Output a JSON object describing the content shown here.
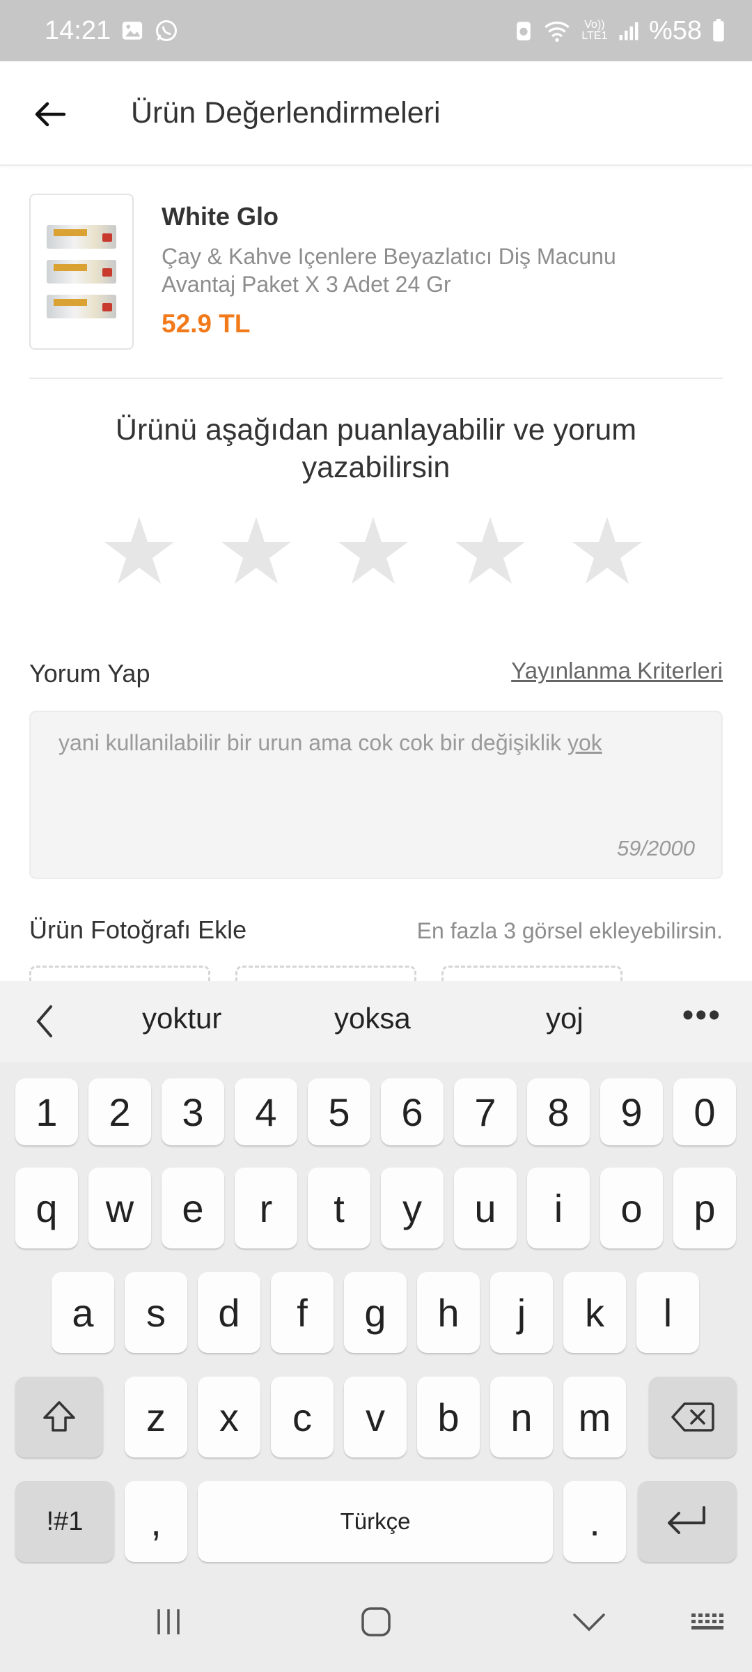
{
  "status_bar": {
    "time": "14:21",
    "network": "Vo)) LTE1",
    "battery": "%58"
  },
  "header": {
    "title": "Ürün Değerlendirmeleri"
  },
  "product": {
    "brand": "White Glo",
    "description": "Çay & Kahve Içenlere Beyazlatıcı Diş Macunu Avantaj Paket X 3 Adet 24 Gr",
    "price": "52.9 TL"
  },
  "rating": {
    "prompt": "Ürünü aşağıdan puanlayabilir ve yorum yazabilirsin",
    "max_stars": 5,
    "selected": 0
  },
  "review": {
    "label": "Yorum Yap",
    "criteria_link": "Yayınlanma Kriterleri",
    "text_main": "yani kullanilabilir bir urun ama cok cok bir değişiklik ",
    "text_underlined": "yok",
    "counter": "59/2000"
  },
  "photos": {
    "label": "Ürün Fotoğrafı Ekle",
    "hint": "En fazla 3 görsel ekleyebilirsin."
  },
  "keyboard": {
    "suggestions": [
      "yoktur",
      "yoksa",
      "yoj"
    ],
    "more": "•••",
    "row_numbers": [
      "1",
      "2",
      "3",
      "4",
      "5",
      "6",
      "7",
      "8",
      "9",
      "0"
    ],
    "row1": [
      "q",
      "w",
      "e",
      "r",
      "t",
      "y",
      "u",
      "i",
      "o",
      "p"
    ],
    "row2": [
      "a",
      "s",
      "d",
      "f",
      "g",
      "h",
      "j",
      "k",
      "l"
    ],
    "row3": [
      "z",
      "x",
      "c",
      "v",
      "b",
      "n",
      "m"
    ],
    "symbols": "!#1",
    "comma": ",",
    "space": "Türkçe",
    "period": "."
  },
  "colors": {
    "accent": "#f27a1a",
    "star_empty": "#e6e6e6"
  }
}
